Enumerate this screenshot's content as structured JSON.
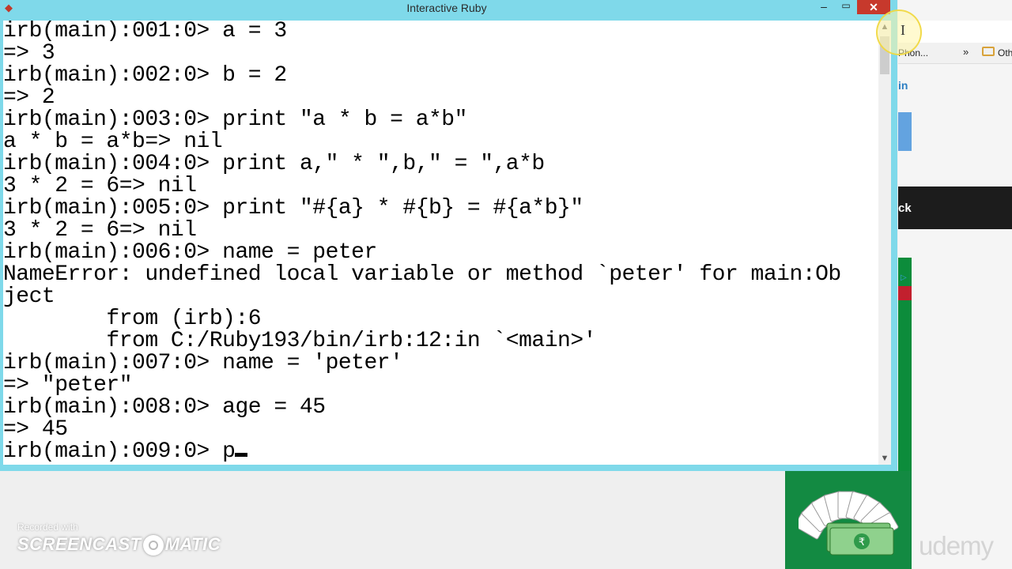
{
  "window": {
    "title": "Interactive Ruby",
    "controls": {
      "minimize": "–",
      "maximize": "▭",
      "close": "✕"
    }
  },
  "console": {
    "lines": [
      "irb(main):001:0> a = 3",
      "=> 3",
      "irb(main):002:0> b = 2",
      "=> 2",
      "irb(main):003:0> print \"a * b = a*b\"",
      "a * b = a*b=> nil",
      "irb(main):004:0> print a,\" * \",b,\" = \",a*b",
      "3 * 2 = 6=> nil",
      "irb(main):005:0> print \"#{a} * #{b} = #{a*b}\"",
      "3 * 2 = 6=> nil",
      "irb(main):006:0> name = peter",
      "NameError: undefined local variable or method `peter' for main:Ob",
      "ject",
      "        from (irb):6",
      "        from C:/Ruby193/bin/irb:12:in `<main>'",
      "irb(main):007:0> name = 'peter'",
      "=> \"peter\"",
      "irb(main):008:0> age = 45",
      "=> 45",
      "irb(main):009:0> p"
    ]
  },
  "background_browser": {
    "bookmark_1": "Phon...",
    "bookmark_more": "»",
    "bookmark_2": "Oth",
    "link_fragment": "in",
    "dark_banner_fragment": "ck",
    "ad_brand": "udemy"
  },
  "watermark": {
    "small": "Recorded with",
    "big_left": "SCREENCAST",
    "big_right": "MATIC"
  }
}
